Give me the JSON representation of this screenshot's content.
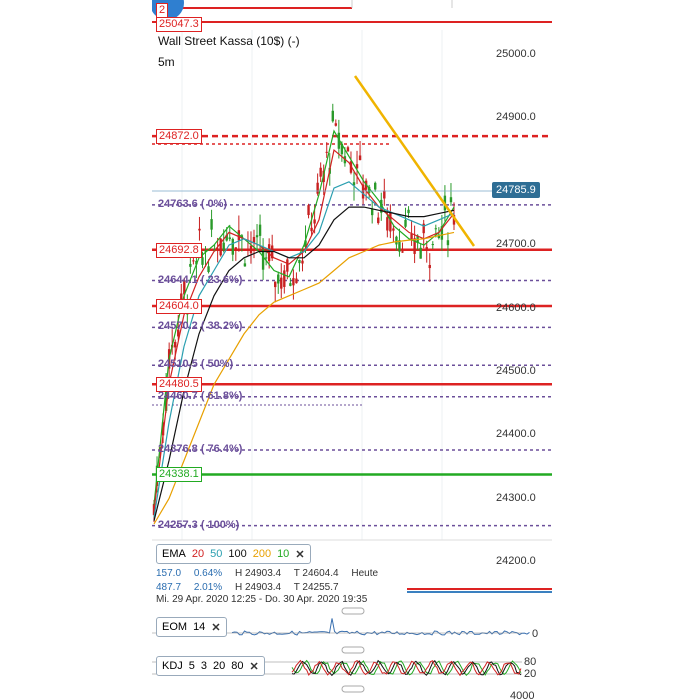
{
  "header": {
    "instrument": "Wall Street Kassa (10$) (-)",
    "timeframe": "5m"
  },
  "top_labels": {
    "partial": "2",
    "level": "25047.3"
  },
  "y_axis_ticks": [
    "25000.0",
    "24900.0",
    "24700.0",
    "24600.0",
    "24500.0",
    "24400.0",
    "24300.0",
    "24200.0"
  ],
  "current_price": "24785.9",
  "levels": [
    {
      "label": "24872.0",
      "style": "red-dashed"
    },
    {
      "label": "24763.6 ( 0%)",
      "style": "fib"
    },
    {
      "label": "24692.8",
      "style": "red"
    },
    {
      "label": "24644.1 ( 23.6%)",
      "style": "fib"
    },
    {
      "label": "24604.0",
      "style": "red"
    },
    {
      "label": "24570.2 ( 38.2%)",
      "style": "fib"
    },
    {
      "label": "24510.5 ( 50%)",
      "style": "fib"
    },
    {
      "label": "24480.5",
      "style": "red"
    },
    {
      "label": "24460.7 ( 61.8%)",
      "style": "fib"
    },
    {
      "label": "24376.8 ( 76.4%)",
      "style": "fib"
    },
    {
      "label": "24338.1",
      "style": "green"
    },
    {
      "label": "24257.3 ( 100%)",
      "style": "fib"
    }
  ],
  "ema_legend": {
    "name": "EMA",
    "periods": [
      "20",
      "50",
      "100",
      "200",
      "10"
    ],
    "colors": [
      "#d22222",
      "#2a9fb0",
      "#111111",
      "#e8a000",
      "#22aa22"
    ]
  },
  "stats": {
    "row1": [
      "157.0",
      "0.64%",
      "H 24903.4",
      "T 24604.4",
      "Heute"
    ],
    "row2": [
      "487.7",
      "2.01%",
      "H 24903.4",
      "T 24255.7"
    ],
    "date_range": "Mi. 29 Apr. 2020 12:25 - Do. 30 Apr. 2020 19:35"
  },
  "eom": {
    "name": "EOM",
    "period": "14",
    "zero_label": "0"
  },
  "kdj": {
    "name": "KDJ",
    "params": [
      "5",
      "3",
      "20",
      "80"
    ],
    "upper_label": "80",
    "lower_label": "20"
  },
  "bottom_axis_label": "4000",
  "chart_data": {
    "type": "line",
    "title": "Wall Street Kassa (10$) (-)",
    "ylim": [
      24200,
      25050
    ],
    "x": [
      0,
      5,
      10,
      15,
      20,
      25,
      30,
      35,
      40,
      45,
      50,
      55,
      60,
      65,
      70,
      75,
      80,
      85,
      90,
      95,
      100
    ],
    "series": [
      {
        "name": "EMA 10",
        "values": [
          24290,
          24520,
          24620,
          24680,
          24700,
          24730,
          24710,
          24690,
          24660,
          24650,
          24700,
          24780,
          24880,
          24840,
          24800,
          24770,
          24730,
          24710,
          24700,
          24720,
          24760
        ]
      },
      {
        "name": "EMA 20",
        "values": [
          24280,
          24480,
          24590,
          24650,
          24690,
          24720,
          24710,
          24700,
          24680,
          24670,
          24690,
          24740,
          24850,
          24830,
          24790,
          24760,
          24740,
          24720,
          24710,
          24720,
          24750
        ]
      },
      {
        "name": "EMA 50",
        "values": [
          24270,
          24420,
          24540,
          24620,
          24660,
          24700,
          24710,
          24700,
          24690,
          24680,
          24690,
          24720,
          24790,
          24800,
          24780,
          24760,
          24750,
          24740,
          24730,
          24740,
          24750
        ]
      },
      {
        "name": "EMA 100",
        "values": [
          24265,
          24360,
          24470,
          24560,
          24620,
          24660,
          24680,
          24690,
          24690,
          24680,
          24680,
          24700,
          24740,
          24760,
          24760,
          24755,
          24750,
          24745,
          24745,
          24750,
          24755
        ]
      },
      {
        "name": "EMA 200",
        "values": [
          24260,
          24300,
          24360,
          24420,
          24480,
          24520,
          24560,
          24590,
          24610,
          24620,
          24630,
          24640,
          24660,
          24680,
          24690,
          24700,
          24705,
          24708,
          24710,
          24715,
          24720
        ]
      }
    ]
  }
}
